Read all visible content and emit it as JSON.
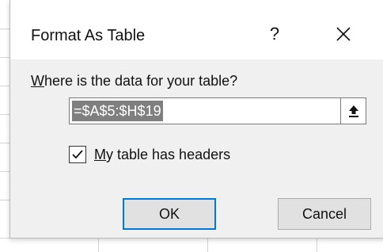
{
  "dialog": {
    "title": "Format As Table",
    "help_label": "?",
    "prompt_underlined": "W",
    "prompt_rest": "here is the data for your table?",
    "range_value": "=$A$5:$H$19",
    "has_headers_checked": true,
    "checkbox_label_underlined": "M",
    "checkbox_label_rest": "y table has headers",
    "ok_label": "OK",
    "cancel_label": "Cancel"
  },
  "icons": {
    "close": "close-icon",
    "collapse": "collapse-dialog-icon",
    "check": "checkmark-icon"
  },
  "colors": {
    "accent": "#0078d7",
    "selection": "#7f7f7f"
  }
}
